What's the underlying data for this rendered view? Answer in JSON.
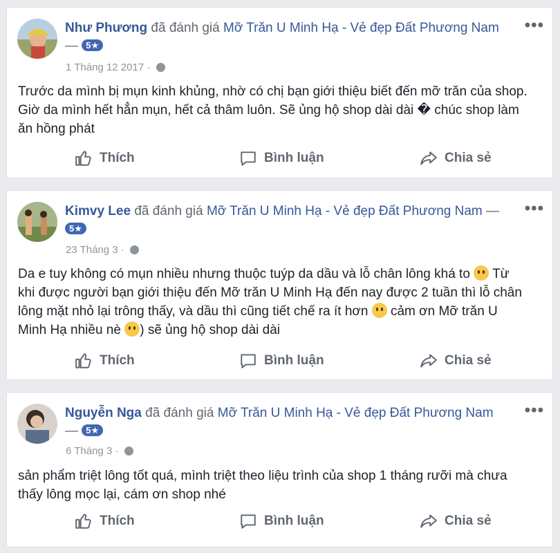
{
  "reviews": [
    {
      "name": "Như Phương",
      "verb": "đã đánh giá",
      "page": "Mỡ Trăn U Minh Hạ - Vẻ đẹp Đất Phương Nam",
      "dash": "—",
      "rating": "5★",
      "date": "1 Tháng 12 2017",
      "text_1": "Trước da mình bị mụn kinh khủng, nhờ có chị bạn giới thiệu biết đến mỡ trăn của shop. Giờ da mình hết hẳn mụn, hết cả thâm luôn. Sẽ ủng hộ shop dài dài � chúc shop làm ăn hồng phát"
    },
    {
      "name": "Kimvy Lee",
      "verb": "đã đánh giá",
      "page": "Mỡ Trăn U Minh Hạ - Vẻ đẹp Đất Phương Nam",
      "dash": "—",
      "rating": "5★",
      "date": "23 Tháng 3",
      "text_1": "Da e tuy không có mụn nhiều nhưng thuộc tuýp da dầu và lỗ chân lông khá to",
      "text_2": "Từ khi được người bạn giới thiệu đến Mỡ trăn U Minh Hạ đến nay được 2 tuần thì lỗ chân lông mặt nhỏ lại trông thấy, và dầu thì cũng tiết chế ra ít hơn",
      "text_3": "cảm ơn Mỡ trăn U Minh Hạ nhiều nè",
      "text_4": ") sẽ ủng hộ shop dài dài"
    },
    {
      "name": "Nguyễn Nga",
      "verb": "đã đánh giá",
      "page": "Mỡ Trăn U Minh Hạ - Vẻ đẹp Đất Phương Nam",
      "dash": "—",
      "rating": "5★",
      "date": "6 Tháng 3",
      "text_1": "sản phẩm triệt lông tốt quá, mình triệt theo liệu trình của shop 1 tháng rưỡi mà chưa thấy lông mọc lại, cám ơn shop nhé"
    }
  ],
  "actions": {
    "like": "Thích",
    "comment": "Bình luận",
    "share": "Chia sẻ"
  },
  "more": "•••",
  "icons": {
    "like": "thumbs-up-icon",
    "comment": "comment-bubble-icon",
    "share": "share-arrow-icon",
    "globe": "globe-icon",
    "more": "more-options-icon"
  }
}
